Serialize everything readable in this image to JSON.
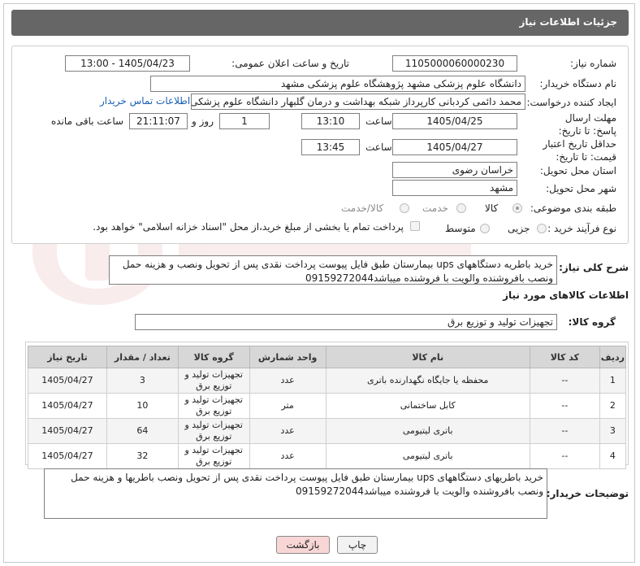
{
  "header": {
    "title": "جزئیات اطلاعات نیاز"
  },
  "labels": {
    "need_number": "شماره نیاز:",
    "announce_datetime": "تاریخ و ساعت اعلان عمومی:",
    "buyer_org": "نام دستگاه خریدار:",
    "requester": "ایجاد کننده درخواست:",
    "reply_deadline": "مهلت ارسال پاسخ: تا تاریخ:",
    "time": "ساعت",
    "days": "روز و",
    "remaining": "ساعت باقی مانده",
    "price_validity": "حداقل تاریخ اعتبار قیمت: تا تاریخ:",
    "delivery_province": "استان محل تحویل:",
    "delivery_city": "شهر محل تحویل:",
    "category": "طبقه بندی موضوعی:",
    "purchase_type": "نوع فرآیند خرید :",
    "summary": "شرح کلی نیاز:",
    "goods_info": "اطلاعات کالاهای مورد نیاز",
    "goods_group": "گروه کالا:",
    "buyer_notes": "توضیحات خریدار:"
  },
  "fields": {
    "need_number": "1105000060000230",
    "announce_datetime": "1405/04/23 - 13:00",
    "buyer_org": "دانشگاه علوم پزشکی مشهد    پژوهشگاه علوم پزشکی مشهد",
    "requester": "محمد دائمی کردبانی کارپرداز شبکه بهداشت و درمان گلبهار دانشگاه علوم پزشکی",
    "contact_link": "اطلاعات تماس خریدار",
    "reply_date": "1405/04/25",
    "reply_time": "13:10",
    "days": "1",
    "remaining_time": "21:11:07",
    "validity_date": "1405/04/27",
    "validity_time": "13:45",
    "province": "خراسان رضوی",
    "city": "مشهد",
    "summary": "خرید باطریه دستگاههای ups بیمارستان طبق فایل پیوست پرداخت نقدی پس از تحویل ونصب و هزینه حمل ونصب بافروشنده والویت با فروشنده  میباشد09159272044",
    "goods_group": "تجهیزات تولید و توزیع برق",
    "buyer_notes": "خرید باطریهای دستگاههای ups بیمارستان طبق فایل پیوست پرداخت نقدی پس از تحویل ونصب  باطریها و هزینه حمل ونصب بافروشنده والویت با فروشنده  میباشد09159272044"
  },
  "category_options": [
    {
      "label": "کالا",
      "selected": true
    },
    {
      "label": "خدمت",
      "selected": false
    },
    {
      "label": "کالا/خدمت",
      "selected": false
    }
  ],
  "purchase_options": [
    {
      "label": "جزیی",
      "selected": false
    },
    {
      "label": "متوسط",
      "selected": false
    }
  ],
  "payment_note": "پرداخت تمام یا بخشی از مبلغ خرید،از محل \"اسناد خزانه اسلامی\" خواهد بود.",
  "table": {
    "headers": [
      "ردیف",
      "کد کالا",
      "نام کالا",
      "واحد شمارش",
      "گروه کالا",
      "تعداد / مقدار",
      "تاریخ نیاز"
    ],
    "rows": [
      [
        "1",
        "--",
        "محفظه یا جایگاه نگهدارنده باتری",
        "عدد",
        "تجهیزات تولید و توزیع برق",
        "3",
        "1405/04/27"
      ],
      [
        "2",
        "--",
        "کابل ساختمانی",
        "متر",
        "تجهیزات تولید و توزیع برق",
        "10",
        "1405/04/27"
      ],
      [
        "3",
        "--",
        "باتری لیتیومی",
        "عدد",
        "تجهیزات تولید و توزیع برق",
        "64",
        "1405/04/27"
      ],
      [
        "4",
        "--",
        "باتری لیتیومی",
        "عدد",
        "تجهیزات تولید و توزیع برق",
        "32",
        "1405/04/27"
      ]
    ]
  },
  "buttons": {
    "print": "چاپ",
    "back": "بازگشت"
  },
  "colors": {
    "header_bg": "#666666",
    "link": "#1a5fb4",
    "back_button_bg": "#f9d6d6"
  }
}
